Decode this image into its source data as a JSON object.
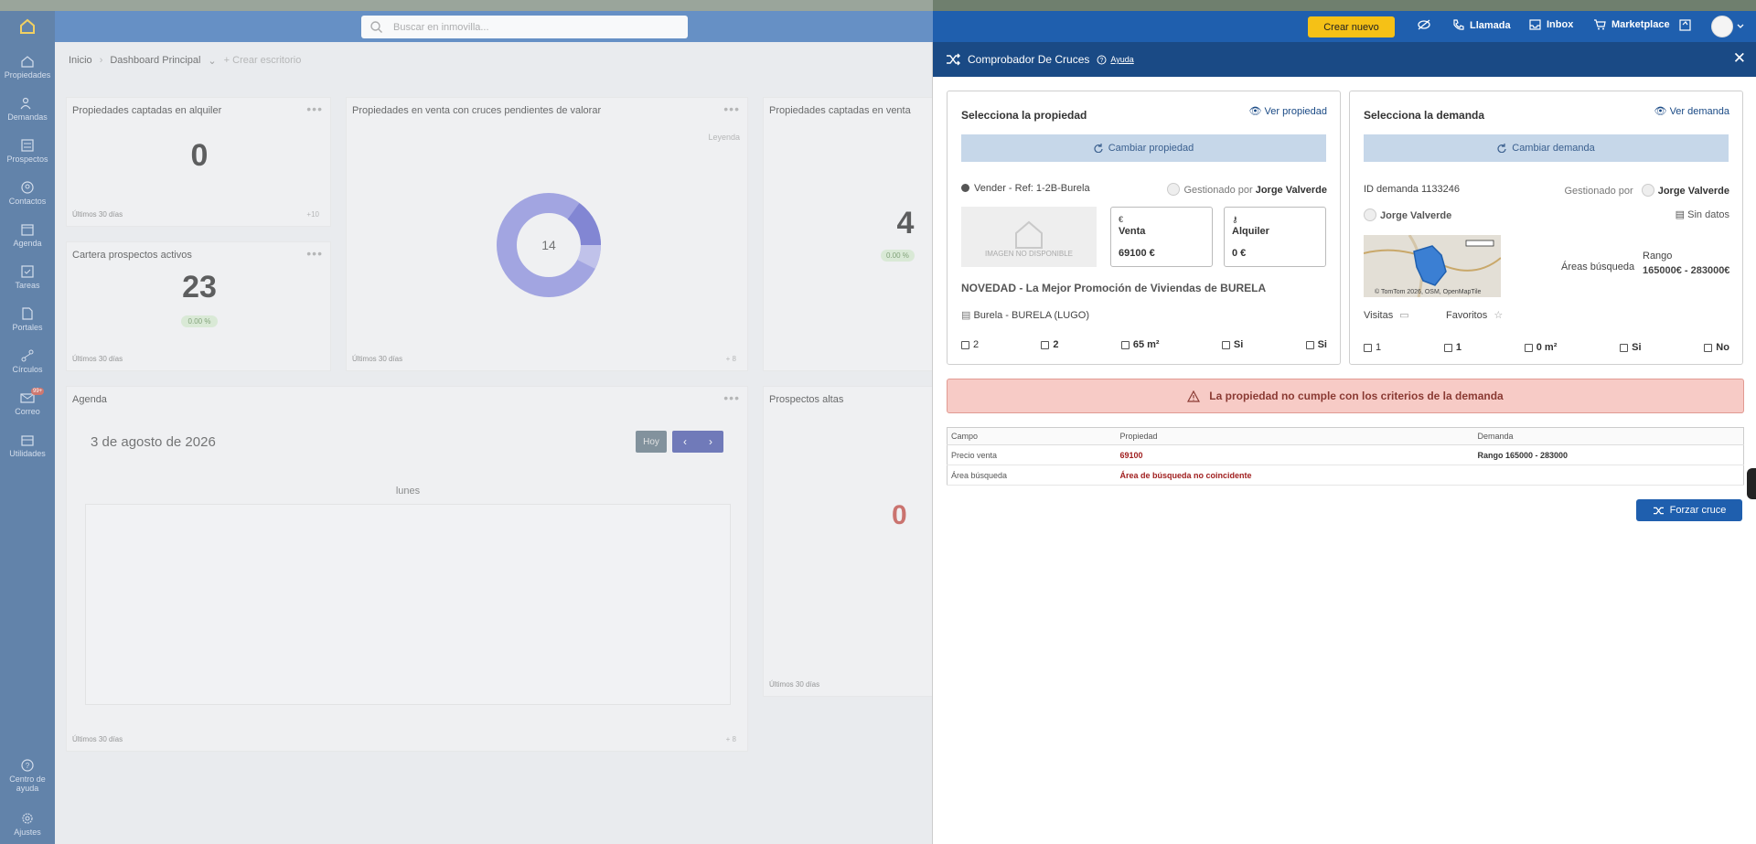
{
  "topbar": {
    "search_placeholder": "Buscar en inmovilla...",
    "create_label": "Crear nuevo",
    "items": [
      "Llamada",
      "Inbox",
      "Marketplace"
    ]
  },
  "sidebar": {
    "items": [
      "Propiedades",
      "Demandas",
      "Prospectos",
      "Contactos",
      "Agenda",
      "Tareas",
      "Portales",
      "Círculos",
      "Correo",
      "Utilidades"
    ],
    "bottom": [
      "Centro de ayuda",
      "Ajustes"
    ],
    "mail_badge": "99+"
  },
  "breadcrumb": {
    "home": "Inicio",
    "dashboard": "Dashboard Principal",
    "create": "+ Crear escritorio"
  },
  "dashboard": {
    "card_rent_title": "Propiedades captadas en alquiler",
    "card_rent_value": "0",
    "card_rent_foot": "Últimos 30 días",
    "card_rent_count": "+10",
    "card_pending_title": "Propiedades en venta con cruces pendientes de valorar",
    "card_pending_legend": "Leyenda",
    "card_pending_value": "14",
    "card_pending_foot": "Últimos 30 días",
    "card_pending_count": "+ 8",
    "card_sale_title": "Propiedades captadas en venta",
    "card_sale_value": "4",
    "card_sale_pct": "0.00 %",
    "card_prosp_title": "Cartera prospectos activos",
    "card_prosp_value": "23",
    "card_prosp_pct": "0.00 %",
    "card_prosp_foot": "Últimos 30 días",
    "agenda_title": "Agenda",
    "agenda_date": "3 de agosto de 2026",
    "agenda_today": "Hoy",
    "agenda_day": "lunes",
    "agenda_foot": "Últimos 30 días",
    "agenda_count": "+ 8",
    "altas_title": "Prospectos altas",
    "altas_value": "0",
    "altas_foot": "Últimos 30 días"
  },
  "panel": {
    "title": "Comprobador De Cruces",
    "help": "Ayuda",
    "property": {
      "title": "Selecciona la propiedad",
      "view": "Ver propiedad",
      "change": "Cambiar propiedad",
      "ref": "Vender - Ref: 1-2B-Burela",
      "managed_by": "Gestionado por",
      "agent": "Jorge Valverde",
      "no_image": "IMAGEN NO DISPONIBLE",
      "sale_label": "Venta",
      "sale_value": "69100 €",
      "rent_label": "Alquiler",
      "rent_value": "0 €",
      "headline": "NOVEDAD - La Mejor Promoción de Viviendas de BURELA",
      "location": "Burela - BURELA (LUGO)",
      "rooms": "2",
      "baths": "2",
      "area": "65 m²",
      "f1": "Si",
      "f2": "Si"
    },
    "demand": {
      "title": "Selecciona la demanda",
      "view": "Ver demanda",
      "change": "Cambiar demanda",
      "id": "ID demanda 1133246",
      "managed_by": "Gestionado por",
      "agent": "Jorge Valverde",
      "contact": "Jorge Valverde",
      "no_data": "Sin datos",
      "map_credit": "© TomTom 2026, OSM, OpenMapTile",
      "areas_label": "Áreas búsqueda",
      "range_label": "Rango",
      "range_value": "165000€ - 283000€",
      "visits": "Visitas",
      "favorites": "Favoritos",
      "rooms": "1",
      "baths": "1",
      "area": "0 m²",
      "f1": "Si",
      "f2": "No"
    },
    "alert": "La propiedad no cumple con los criterios de la demanda",
    "table": {
      "headers": [
        "Campo",
        "Propiedad",
        "Demanda"
      ],
      "rows": [
        [
          "Precio venta",
          "69100",
          "Rango 165000 - 283000"
        ],
        [
          "Área búsqueda",
          "Área de búsqueda no coincidente",
          ""
        ]
      ]
    },
    "force": "Forzar cruce"
  },
  "colors": {
    "primary": "#1f5fae",
    "sidebar": "#1a4a85",
    "accent": "#f5c116",
    "alert_bg": "#f7cbc6",
    "error": "#a01f1f"
  }
}
